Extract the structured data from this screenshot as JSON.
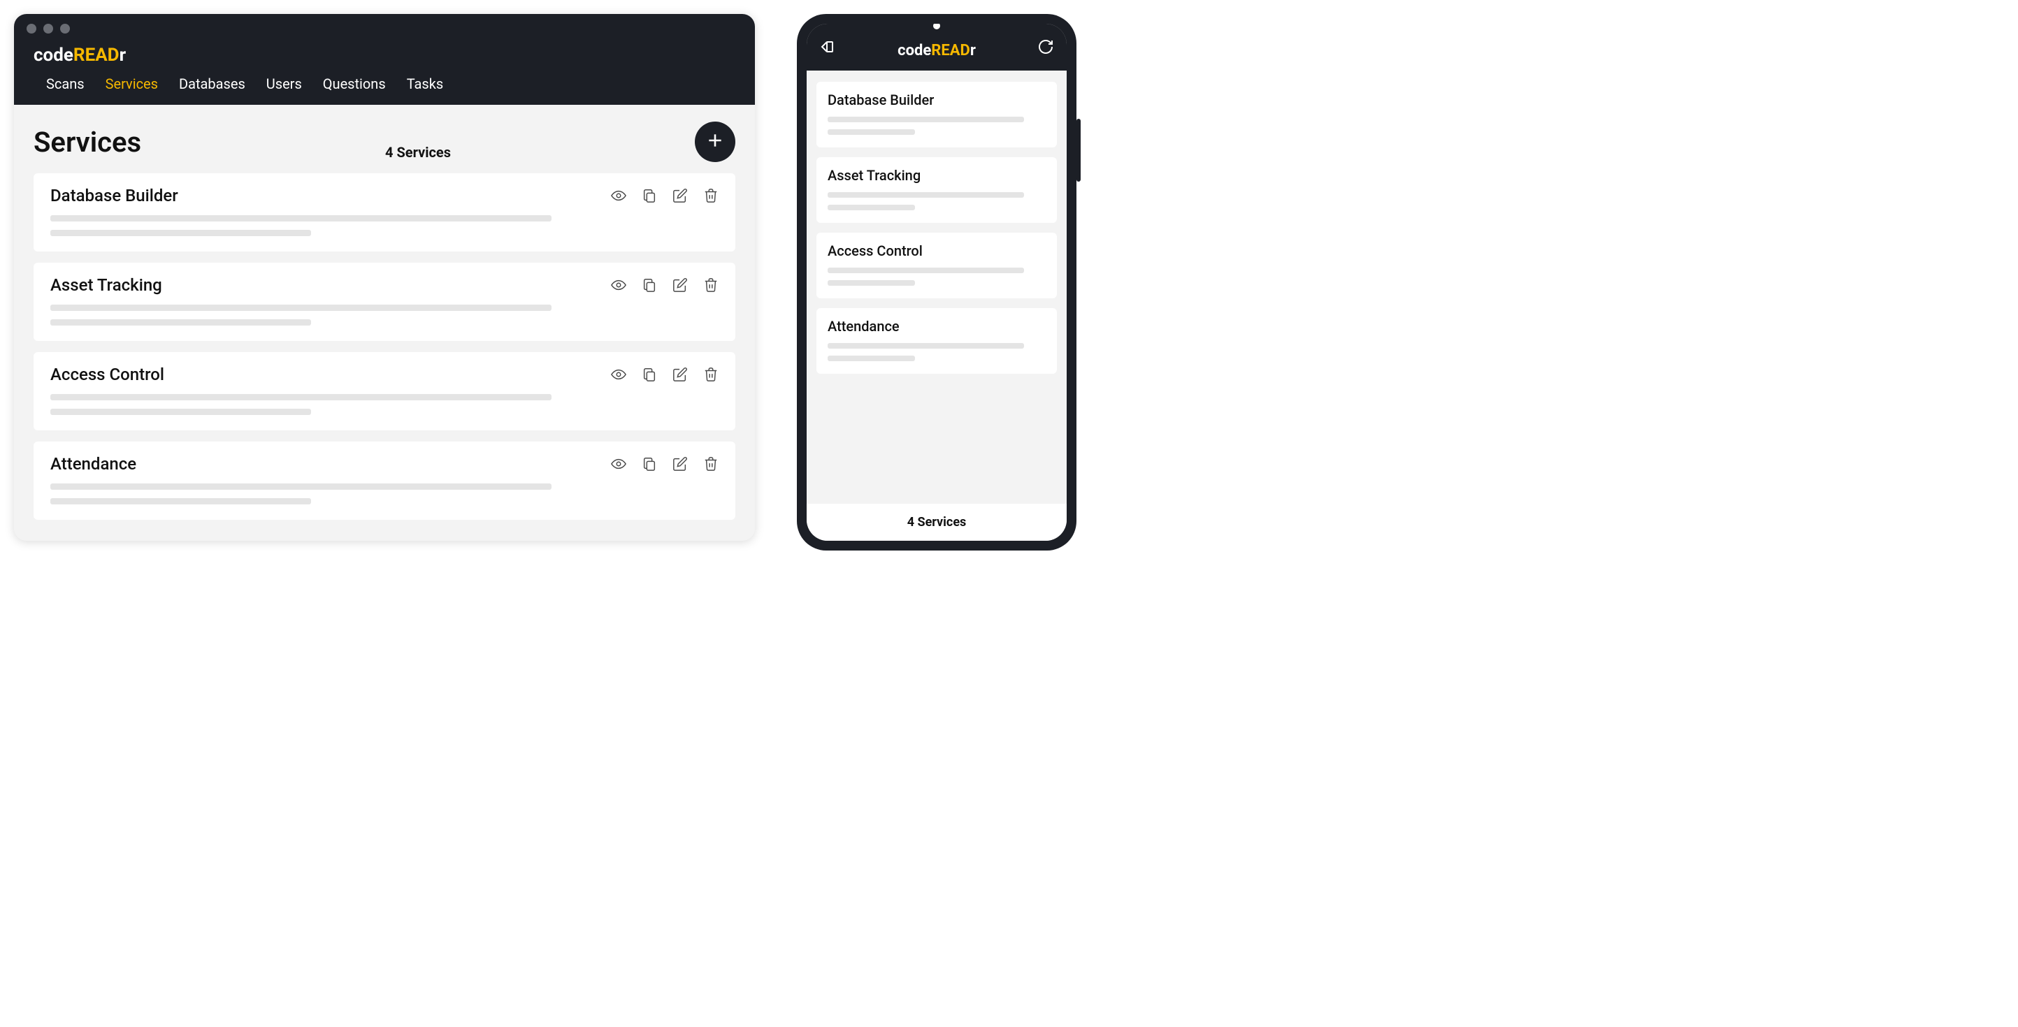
{
  "brand": {
    "part1": "code",
    "part2": "READ",
    "part3": "r"
  },
  "nav": {
    "items": [
      {
        "label": "Scans",
        "active": false
      },
      {
        "label": "Services",
        "active": true
      },
      {
        "label": "Databases",
        "active": false
      },
      {
        "label": "Users",
        "active": false
      },
      {
        "label": "Questions",
        "active": false
      },
      {
        "label": "Tasks",
        "active": false
      }
    ]
  },
  "page": {
    "title": "Services",
    "count_label": "4 Services"
  },
  "services": [
    {
      "title": "Database Builder"
    },
    {
      "title": "Asset Tracking"
    },
    {
      "title": "Access Control"
    },
    {
      "title": "Attendance"
    }
  ],
  "mobile": {
    "footer_label": "4 Services"
  }
}
